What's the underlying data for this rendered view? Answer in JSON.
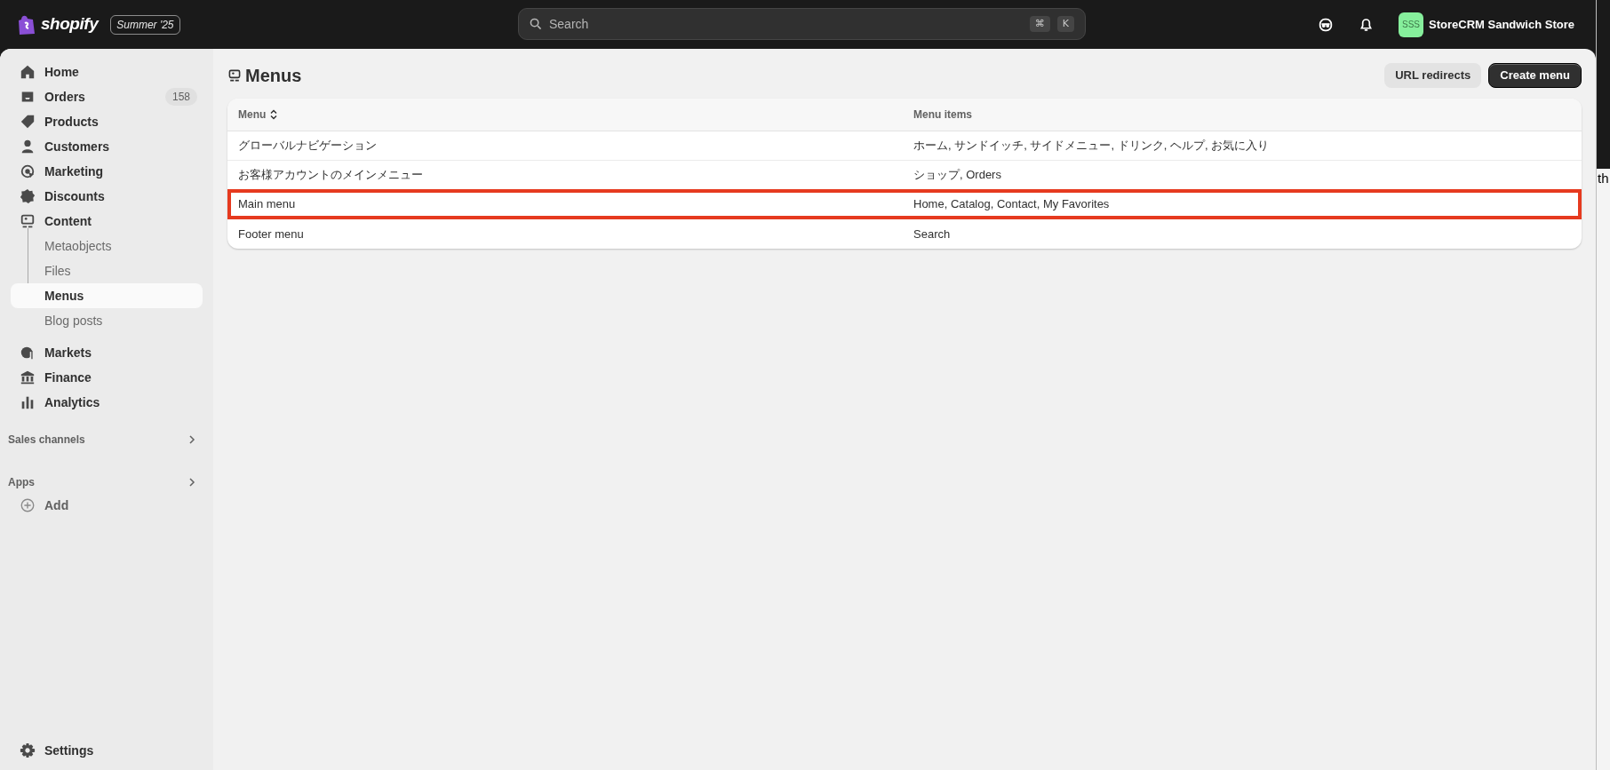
{
  "topbar": {
    "logo": "shopify",
    "edition": "Summer '25",
    "search": {
      "placeholder": "Search",
      "shortcut": [
        "⌘",
        "K"
      ]
    },
    "store": {
      "initials": "SSS",
      "name": "StoreCRM Sandwich Store"
    }
  },
  "sidebar": {
    "items": [
      {
        "label": "Home",
        "selected": false
      },
      {
        "label": "Orders",
        "badge": "158",
        "selected": false
      },
      {
        "label": "Products",
        "selected": false
      },
      {
        "label": "Customers",
        "selected": false
      },
      {
        "label": "Marketing",
        "selected": false
      },
      {
        "label": "Discounts",
        "selected": false
      },
      {
        "label": "Content",
        "selected": false,
        "children": [
          {
            "label": "Metaobjects",
            "selected": false
          },
          {
            "label": "Files",
            "selected": false
          },
          {
            "label": "Menus",
            "selected": true
          },
          {
            "label": "Blog posts",
            "selected": false
          }
        ]
      },
      {
        "label": "Markets",
        "selected": false
      },
      {
        "label": "Finance",
        "selected": false
      },
      {
        "label": "Analytics",
        "selected": false
      }
    ],
    "sections": [
      {
        "label": "Sales channels"
      },
      {
        "label": "Apps",
        "items": [
          {
            "label": "Add"
          }
        ]
      }
    ],
    "footer": {
      "label": "Settings"
    }
  },
  "page": {
    "title": "Menus",
    "buttons": [
      {
        "label": "URL redirects",
        "kind": "secondary"
      },
      {
        "label": "Create menu",
        "kind": "primary"
      }
    ],
    "table": {
      "columns": [
        {
          "label": "Menu",
          "sortable": true
        },
        {
          "label": "Menu items",
          "sortable": false
        }
      ],
      "rows": [
        {
          "cells": [
            "グローバルナビゲーション",
            "ホーム, サンドイッチ, サイドメニュー, ドリンク, ヘルプ, お気に入り"
          ],
          "highlighted": false
        },
        {
          "cells": [
            "お客様アカウントのメインメニュー",
            "ショップ, Orders"
          ],
          "highlighted": false
        },
        {
          "cells": [
            "Main menu",
            "Home, Catalog, Contact, My Favorites"
          ],
          "highlighted": true
        },
        {
          "cells": [
            "Footer menu",
            "Search"
          ],
          "highlighted": false
        }
      ]
    }
  },
  "background_window": {
    "text": "th"
  }
}
